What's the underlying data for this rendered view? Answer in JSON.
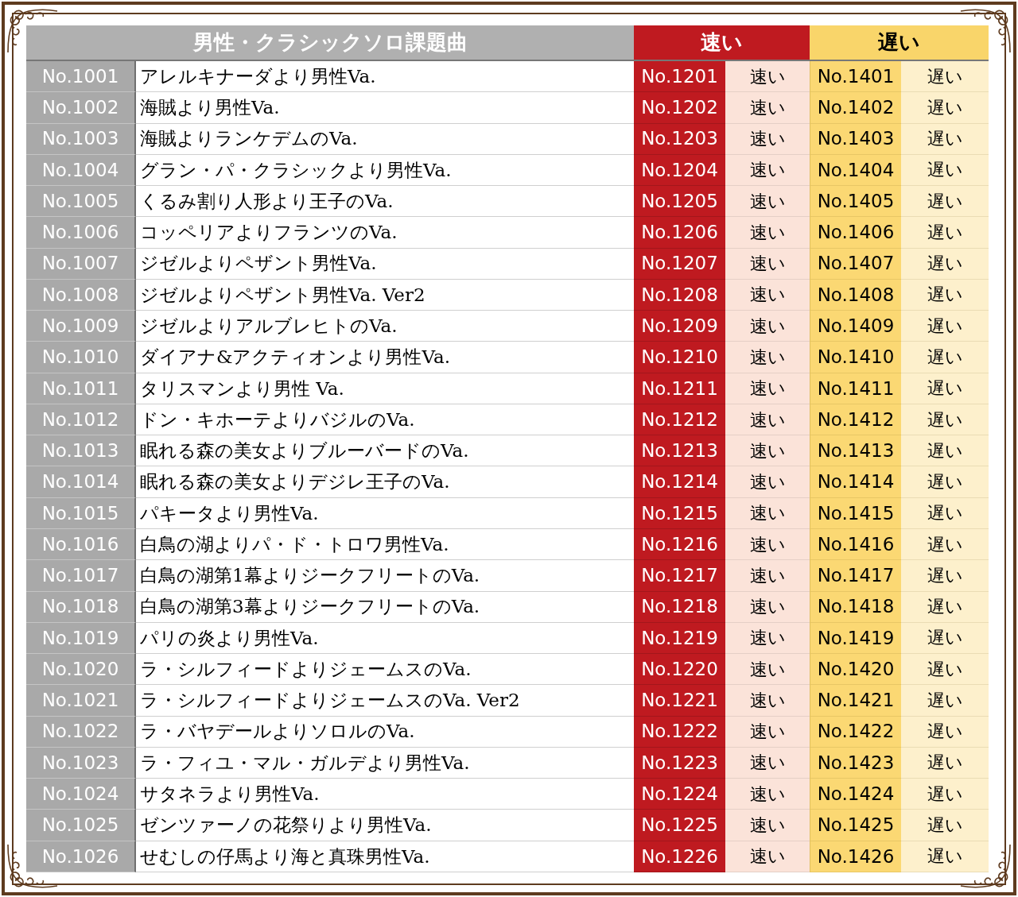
{
  "header": {
    "title": "男性・クラシックソロ課題曲",
    "fast": "速い",
    "slow": "遅い"
  },
  "rows": [
    {
      "no": "No.1001",
      "title": "アレルキナーダより男性Va.",
      "fast_no": "No.1201",
      "fast": "速い",
      "slow_no": "No.1401",
      "slow": "遅い"
    },
    {
      "no": "No.1002",
      "title": "海賊より男性Va.",
      "fast_no": "No.1202",
      "fast": "速い",
      "slow_no": "No.1402",
      "slow": "遅い"
    },
    {
      "no": "No.1003",
      "title": "海賊よりランケデムのVa.",
      "fast_no": "No.1203",
      "fast": "速い",
      "slow_no": "No.1403",
      "slow": "遅い"
    },
    {
      "no": "No.1004",
      "title": "グラン・パ・クラシックより男性Va.",
      "fast_no": "No.1204",
      "fast": "速い",
      "slow_no": "No.1404",
      "slow": "遅い"
    },
    {
      "no": "No.1005",
      "title": "くるみ割り人形より王子のVa.",
      "fast_no": "No.1205",
      "fast": "速い",
      "slow_no": "No.1405",
      "slow": "遅い"
    },
    {
      "no": "No.1006",
      "title": "コッペリアよりフランツのVa.",
      "fast_no": "No.1206",
      "fast": "速い",
      "slow_no": "No.1406",
      "slow": "遅い"
    },
    {
      "no": "No.1007",
      "title": "ジゼルよりペザント男性Va.",
      "fast_no": "No.1207",
      "fast": "速い",
      "slow_no": "No.1407",
      "slow": "遅い"
    },
    {
      "no": "No.1008",
      "title": "ジゼルよりペザント男性Va. Ver2",
      "fast_no": "No.1208",
      "fast": "速い",
      "slow_no": "No.1408",
      "slow": "遅い"
    },
    {
      "no": "No.1009",
      "title": "ジゼルよりアルブレヒトのVa.",
      "fast_no": "No.1209",
      "fast": "速い",
      "slow_no": "No.1409",
      "slow": "遅い"
    },
    {
      "no": "No.1010",
      "title": "ダイアナ&アクティオンより男性Va.",
      "fast_no": "No.1210",
      "fast": "速い",
      "slow_no": "No.1410",
      "slow": "遅い"
    },
    {
      "no": "No.1011",
      "title": "タリスマンより男性 Va.",
      "fast_no": "No.1211",
      "fast": "速い",
      "slow_no": "No.1411",
      "slow": "遅い"
    },
    {
      "no": "No.1012",
      "title": "ドン・キホーテよりバジルのVa.",
      "fast_no": "No.1212",
      "fast": "速い",
      "slow_no": "No.1412",
      "slow": "遅い"
    },
    {
      "no": "No.1013",
      "title": "眠れる森の美女よりブルーバードのVa.",
      "fast_no": "No.1213",
      "fast": "速い",
      "slow_no": "No.1413",
      "slow": "遅い"
    },
    {
      "no": "No.1014",
      "title": "眠れる森の美女よりデジレ王子のVa.",
      "fast_no": "No.1214",
      "fast": "速い",
      "slow_no": "No.1414",
      "slow": "遅い"
    },
    {
      "no": "No.1015",
      "title": "パキータより男性Va.",
      "fast_no": "No.1215",
      "fast": "速い",
      "slow_no": "No.1415",
      "slow": "遅い"
    },
    {
      "no": "No.1016",
      "title": "白鳥の湖よりパ・ド・トロワ男性Va.",
      "fast_no": "No.1216",
      "fast": "速い",
      "slow_no": "No.1416",
      "slow": "遅い"
    },
    {
      "no": "No.1017",
      "title": "白鳥の湖第1幕よりジークフリートのVa.",
      "fast_no": "No.1217",
      "fast": "速い",
      "slow_no": "No.1417",
      "slow": "遅い"
    },
    {
      "no": "No.1018",
      "title": "白鳥の湖第3幕よりジークフリートのVa.",
      "fast_no": "No.1218",
      "fast": "速い",
      "slow_no": "No.1418",
      "slow": "遅い"
    },
    {
      "no": "No.1019",
      "title": "パリの炎より男性Va.",
      "fast_no": "No.1219",
      "fast": "速い",
      "slow_no": "No.1419",
      "slow": "遅い"
    },
    {
      "no": "No.1020",
      "title": "ラ・シルフィードよりジェームスのVa.",
      "fast_no": "No.1220",
      "fast": "速い",
      "slow_no": "No.1420",
      "slow": "遅い"
    },
    {
      "no": "No.1021",
      "title": "ラ・シルフィードよりジェームスのVa. Ver2",
      "fast_no": "No.1221",
      "fast": "速い",
      "slow_no": "No.1421",
      "slow": "遅い"
    },
    {
      "no": "No.1022",
      "title": "ラ・バヤデールよりソロルのVa.",
      "fast_no": "No.1222",
      "fast": "速い",
      "slow_no": "No.1422",
      "slow": "遅い"
    },
    {
      "no": "No.1023",
      "title": "ラ・フィユ・マル・ガルデより男性Va.",
      "fast_no": "No.1223",
      "fast": "速い",
      "slow_no": "No.1423",
      "slow": "遅い"
    },
    {
      "no": "No.1024",
      "title": "サタネラより男性Va.",
      "fast_no": "No.1224",
      "fast": "速い",
      "slow_no": "No.1424",
      "slow": "遅い"
    },
    {
      "no": "No.1025",
      "title": "ゼンツァーノの花祭りより男性Va.",
      "fast_no": "No.1225",
      "fast": "速い",
      "slow_no": "No.1425",
      "slow": "遅い"
    },
    {
      "no": "No.1026",
      "title": "せむしの仔馬より海と真珠男性Va.",
      "fast_no": "No.1226",
      "fast": "速い",
      "slow_no": "No.1426",
      "slow": "遅い"
    }
  ]
}
